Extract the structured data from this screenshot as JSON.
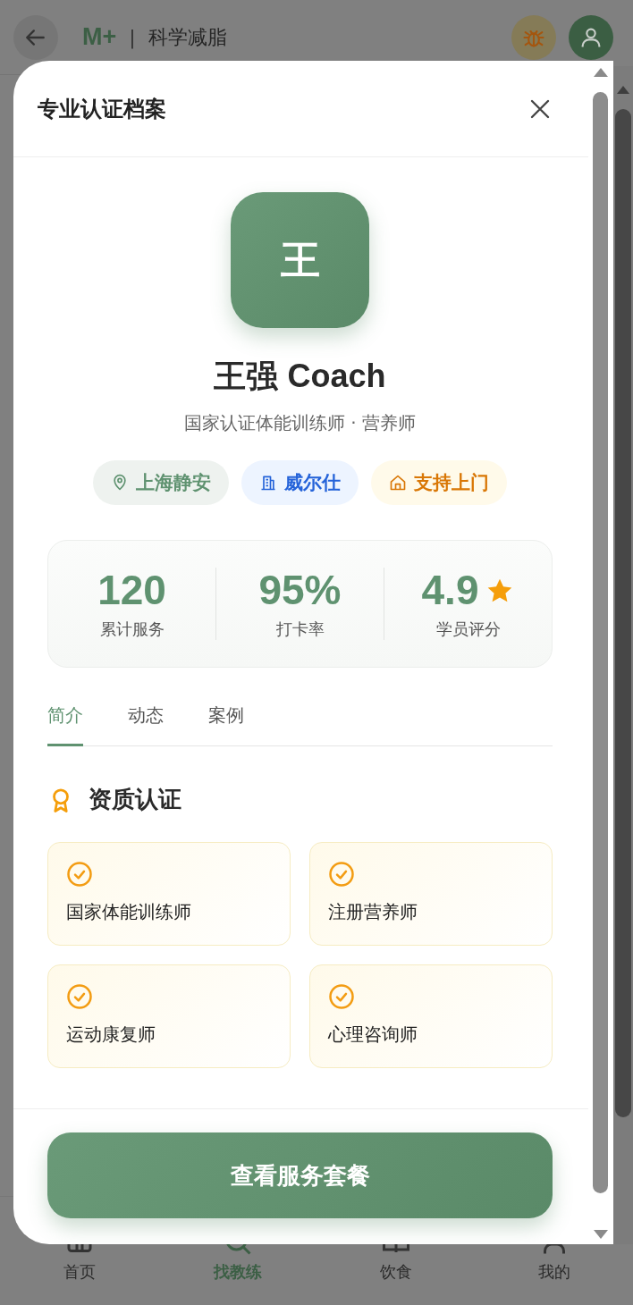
{
  "app_bar": {
    "logo": "M+",
    "separator": "|",
    "title": "科学减脂"
  },
  "bottom_nav": [
    {
      "label": "首页",
      "selected": false
    },
    {
      "label": "找教练",
      "selected": true
    },
    {
      "label": "饮食",
      "selected": false
    },
    {
      "label": "我的",
      "selected": false
    }
  ],
  "modal": {
    "title": "专业认证档案",
    "coach": {
      "avatar_initial": "王",
      "name": "王强 Coach",
      "subtitle": "国家认证体能训练师 · 营养师"
    },
    "tags": [
      {
        "label": "上海静安",
        "kind": "location"
      },
      {
        "label": "威尔仕",
        "kind": "gym"
      },
      {
        "label": "支持上门",
        "kind": "home"
      }
    ],
    "stats": [
      {
        "value": "120",
        "label": "累计服务",
        "kind": "plain"
      },
      {
        "value": "95%",
        "label": "打卡率",
        "kind": "plain"
      },
      {
        "value": "4.9",
        "label": "学员评分",
        "kind": "rating"
      }
    ],
    "tabs": [
      {
        "label": "简介",
        "selected": true
      },
      {
        "label": "动态",
        "selected": false
      },
      {
        "label": "案例",
        "selected": false
      }
    ],
    "section_title": "资质认证",
    "certifications": [
      "国家体能训练师",
      "注册营养师",
      "运动康复师",
      "心理咨询师"
    ],
    "cta": "查看服务套餐"
  }
}
